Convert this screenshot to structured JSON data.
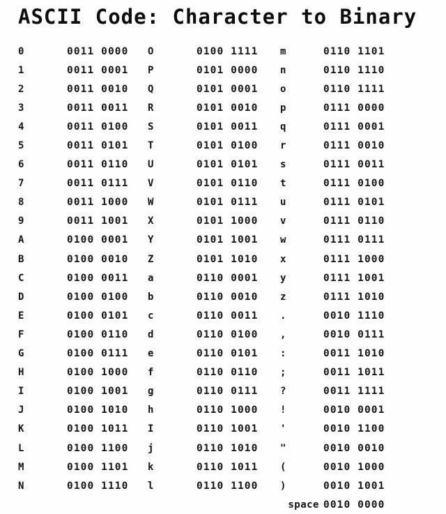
{
  "title": "ASCII Code: Character to Binary",
  "columns": [
    {
      "id": "column-1",
      "rows": [
        {
          "char": "0",
          "bits": "0011 0000"
        },
        {
          "char": "1",
          "bits": "0011 0001"
        },
        {
          "char": "2",
          "bits": "0011 0010"
        },
        {
          "char": "3",
          "bits": "0011 0011"
        },
        {
          "char": "4",
          "bits": "0011 0100"
        },
        {
          "char": "5",
          "bits": "0011 0101"
        },
        {
          "char": "6",
          "bits": "0011 0110"
        },
        {
          "char": "7",
          "bits": "0011 0111"
        },
        {
          "char": "8",
          "bits": "0011 1000"
        },
        {
          "char": "9",
          "bits": "0011 1001"
        },
        {
          "char": "A",
          "bits": "0100 0001"
        },
        {
          "char": "B",
          "bits": "0100 0010"
        },
        {
          "char": "C",
          "bits": "0100 0011"
        },
        {
          "char": "D",
          "bits": "0100 0100"
        },
        {
          "char": "E",
          "bits": "0100 0101"
        },
        {
          "char": "F",
          "bits": "0100 0110"
        },
        {
          "char": "G",
          "bits": "0100 0111"
        },
        {
          "char": "H",
          "bits": "0100 1000"
        },
        {
          "char": "I",
          "bits": "0100 1001"
        },
        {
          "char": "J",
          "bits": "0100 1010"
        },
        {
          "char": "K",
          "bits": "0100 1011"
        },
        {
          "char": "L",
          "bits": "0100 1100"
        },
        {
          "char": "M",
          "bits": "0100 1101"
        },
        {
          "char": "N",
          "bits": "0100 1110"
        }
      ]
    },
    {
      "id": "column-2",
      "rows": [
        {
          "char": "O",
          "bits": "0100 1111"
        },
        {
          "char": "P",
          "bits": "0101 0000"
        },
        {
          "char": "Q",
          "bits": "0101 0001"
        },
        {
          "char": "R",
          "bits": "0101 0010"
        },
        {
          "char": "S",
          "bits": "0101 0011"
        },
        {
          "char": "T",
          "bits": "0101 0100"
        },
        {
          "char": "U",
          "bits": "0101 0101"
        },
        {
          "char": "V",
          "bits": "0101 0110"
        },
        {
          "char": "W",
          "bits": "0101 0111"
        },
        {
          "char": "X",
          "bits": "0101 1000"
        },
        {
          "char": "Y",
          "bits": "0101 1001"
        },
        {
          "char": "Z",
          "bits": "0101 1010"
        },
        {
          "char": "a",
          "bits": "0110 0001"
        },
        {
          "char": "b",
          "bits": "0110 0010"
        },
        {
          "char": "c",
          "bits": "0110 0011"
        },
        {
          "char": "d",
          "bits": "0110 0100"
        },
        {
          "char": "e",
          "bits": "0110 0101"
        },
        {
          "char": "f",
          "bits": "0110 0110"
        },
        {
          "char": "g",
          "bits": "0110 0111"
        },
        {
          "char": "h",
          "bits": "0110 1000"
        },
        {
          "char": "I",
          "bits": "0110 1001"
        },
        {
          "char": "j",
          "bits": "0110 1010"
        },
        {
          "char": "k",
          "bits": "0110 1011"
        },
        {
          "char": "l",
          "bits": "0110 1100"
        }
      ]
    },
    {
      "id": "column-3",
      "rows": [
        {
          "char": "m",
          "bits": "0110 1101"
        },
        {
          "char": "n",
          "bits": "0110 1110"
        },
        {
          "char": "o",
          "bits": "0110 1111"
        },
        {
          "char": "p",
          "bits": "0111 0000"
        },
        {
          "char": "q",
          "bits": "0111 0001"
        },
        {
          "char": "r",
          "bits": "0111 0010"
        },
        {
          "char": "s",
          "bits": "0111 0011"
        },
        {
          "char": "t",
          "bits": "0111 0100"
        },
        {
          "char": "u",
          "bits": "0111 0101"
        },
        {
          "char": "v",
          "bits": "0111 0110"
        },
        {
          "char": "w",
          "bits": "0111 0111"
        },
        {
          "char": "x",
          "bits": "0111 1000"
        },
        {
          "char": "y",
          "bits": "0111 1001"
        },
        {
          "char": "z",
          "bits": "0111 1010"
        },
        {
          "char": ".",
          "bits": "0010 1110"
        },
        {
          "char": ",",
          "bits": "0010 0111"
        },
        {
          "char": ":",
          "bits": "0011 1010"
        },
        {
          "char": ";",
          "bits": "0011 1011"
        },
        {
          "char": "?",
          "bits": "0011 1111"
        },
        {
          "char": "!",
          "bits": "0010 0001"
        },
        {
          "char": "'",
          "bits": "0010 1100"
        },
        {
          "char": "\"",
          "bits": "0010 0010"
        },
        {
          "char": "(",
          "bits": "0010 1000"
        },
        {
          "char": ")",
          "bits": "0010 1001"
        },
        {
          "char": "space",
          "bits": "0010 0000"
        }
      ]
    }
  ]
}
